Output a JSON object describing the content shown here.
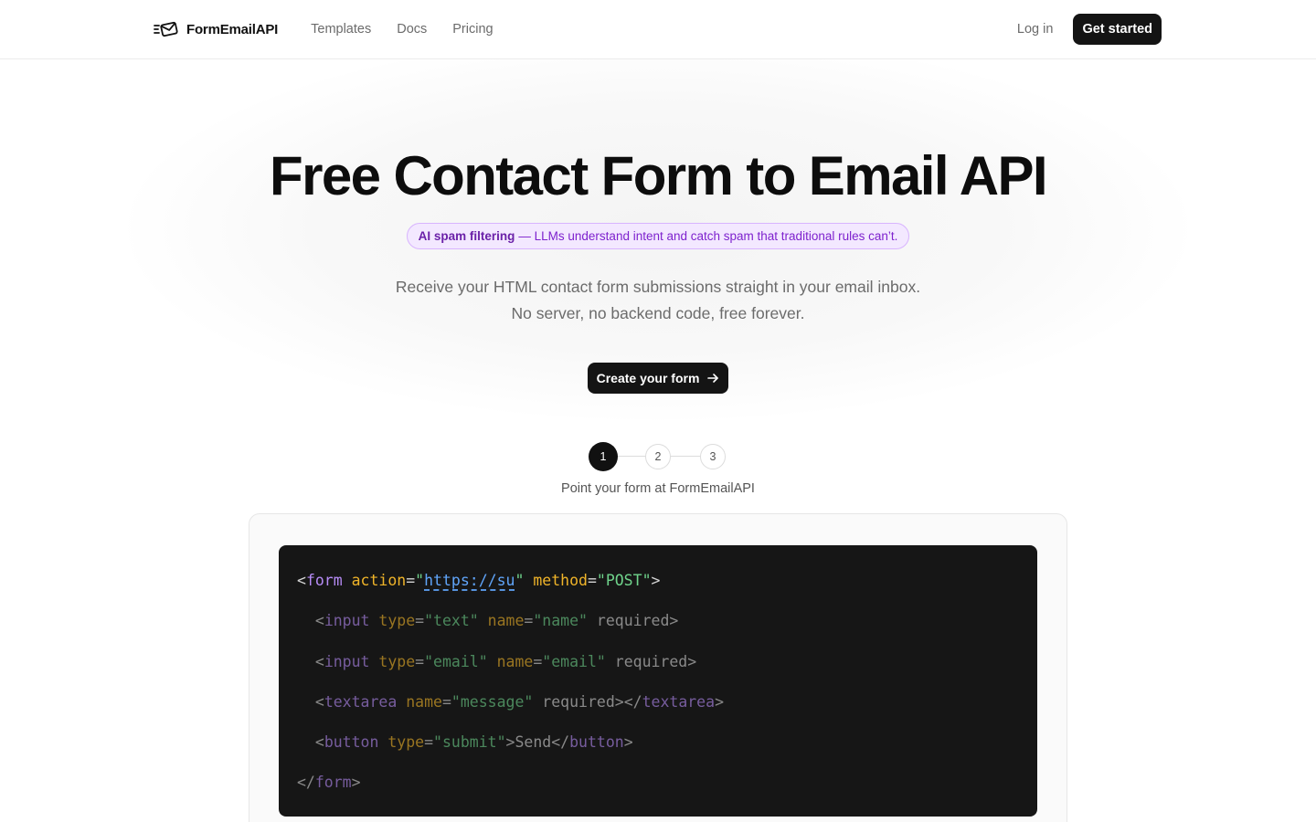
{
  "nav": {
    "brand": "FormEmailAPI",
    "links": [
      "Templates",
      "Docs",
      "Pricing"
    ],
    "login": "Log in",
    "get_started": "Get started"
  },
  "hero": {
    "title": "Free Contact Form to Email API",
    "pill_strong": "AI spam filtering",
    "pill_rest": "— LLMs understand intent and catch spam that traditional rules can’t.",
    "subtitle_line1": "Receive your HTML contact form submissions straight in your email inbox.",
    "subtitle_line2": "No server, no backend code, free forever.",
    "cta": "Create your form"
  },
  "steps": {
    "items": [
      "1",
      "2",
      "3"
    ],
    "active_index": 0,
    "caption": "Point your form at FormEmailAPI"
  },
  "code": {
    "form_action_url": "https://su",
    "form_method": "POST",
    "input1_type": "text",
    "input1_name": "name",
    "input2_type": "email",
    "input2_name": "email",
    "textarea_name": "message",
    "button_type": "submit",
    "button_text": "Send"
  },
  "colors": {
    "accent_dark": "#141414",
    "pill_bg": "#f3e8ff",
    "pill_text": "#7e22ce",
    "code_bg": "#161616"
  },
  "icons": {
    "brand": "mail-send-icon",
    "cta": "arrow-right-icon"
  }
}
